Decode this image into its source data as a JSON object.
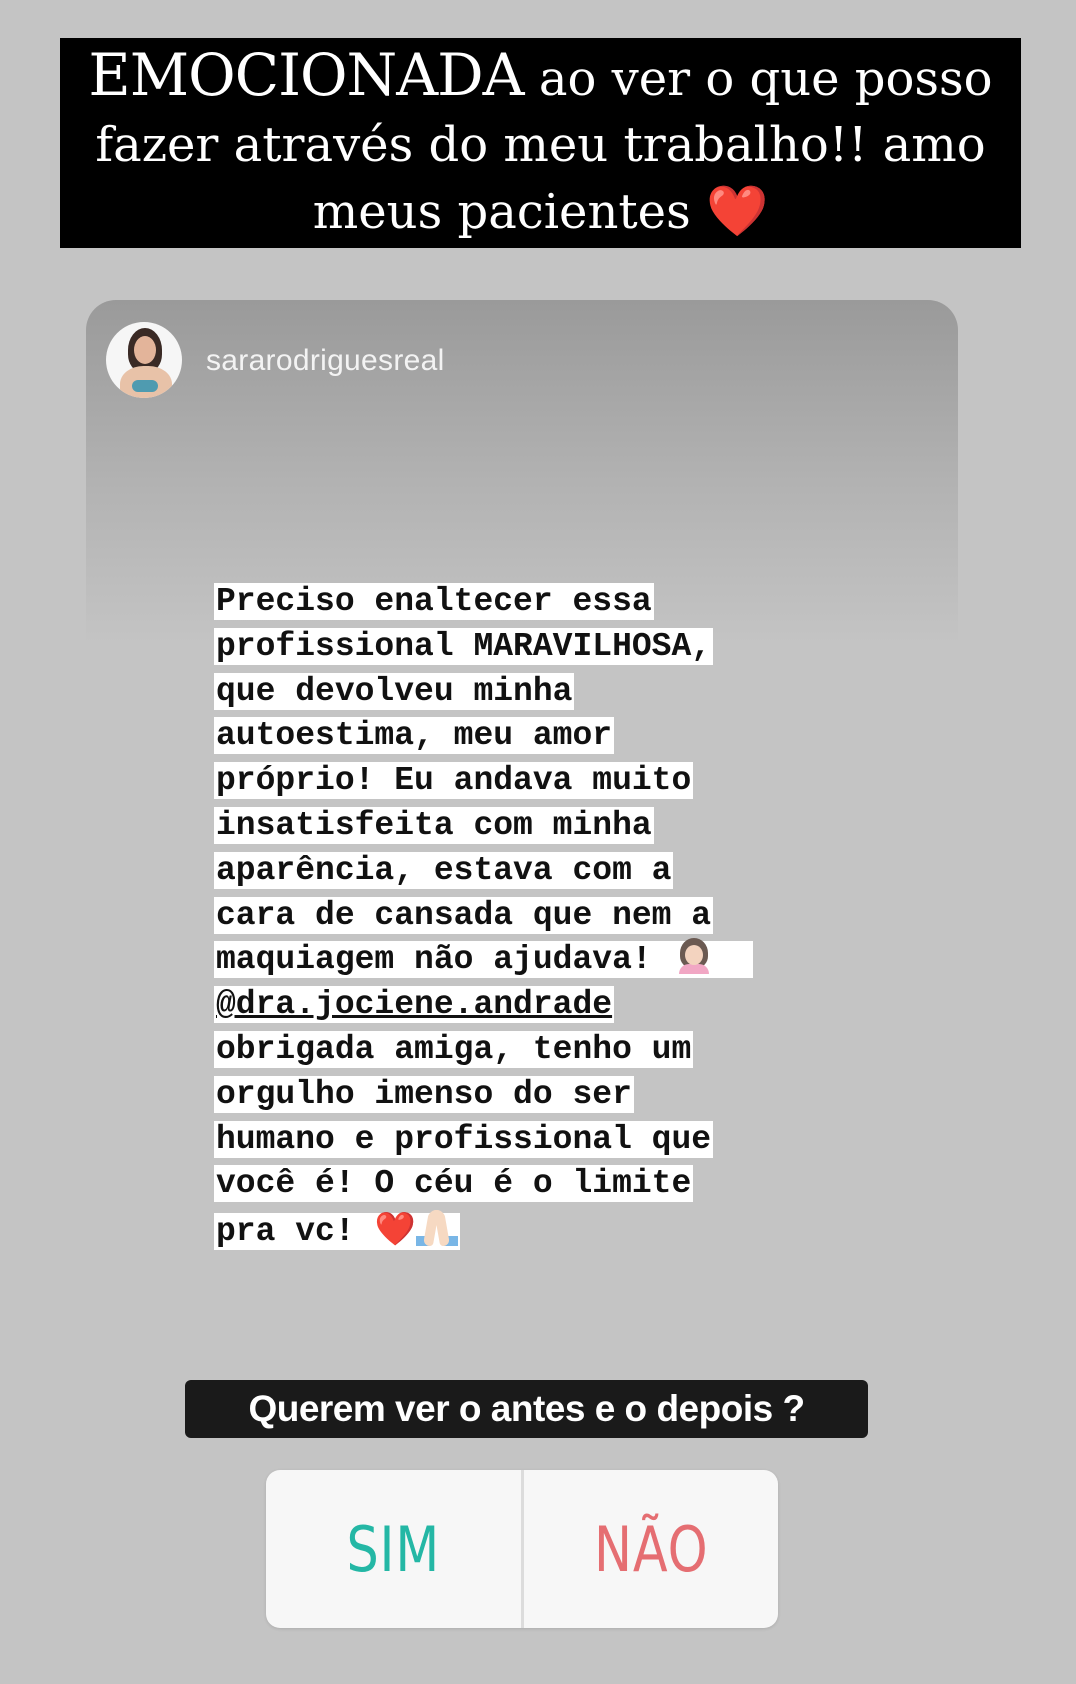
{
  "caption": {
    "line1_emphasis": "EMOCIONADA",
    "line1_rest": " ao ver o que posso",
    "line2": "fazer através do meu trabalho!! amo",
    "line3": "meus pacientes",
    "line3_emoji": "❤️"
  },
  "post": {
    "username": "sararodriguesreal",
    "lines": [
      "Preciso enaltecer essa",
      "profissional MARAVILHOSA,",
      "que devolveu minha",
      "autoestima, meu amor",
      "próprio! Eu andava muito",
      "insatisfeita com minha",
      "aparência, estava com a",
      "cara de cansada que nem a",
      "maquiagem não ajudava! ",
      "@dra.jociene.andrade",
      "obrigada amiga, tenho um",
      "orgulho imenso do ser",
      "humano e profissional que",
      "você é! O céu é o limite",
      "pra vc! "
    ],
    "final_heart": "❤️"
  },
  "question": "Querem ver o antes e o depois ?",
  "poll": {
    "yes": "SIM",
    "no": "NÃO"
  },
  "colors": {
    "background": "#c4c4c4",
    "poll_yes": "#24b7a5",
    "poll_no": "#e56e72"
  }
}
